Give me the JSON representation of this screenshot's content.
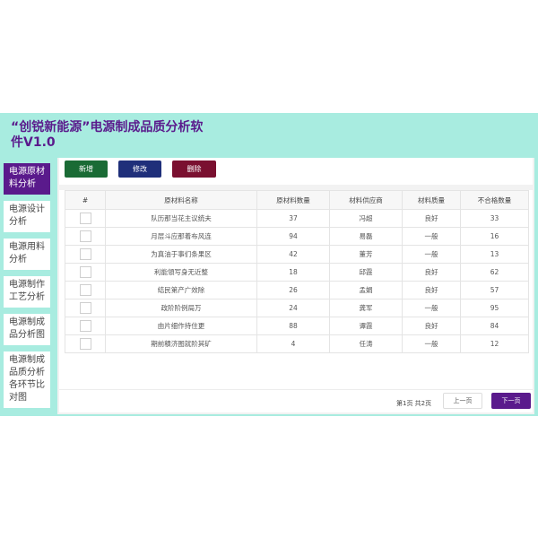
{
  "app": {
    "title": "“创锐新能源”电源制成品质分析软件V1.0"
  },
  "sidebar": {
    "items": [
      {
        "label": "电源原材料分析",
        "active": true
      },
      {
        "label": "电源设计分析"
      },
      {
        "label": "电源用料分析"
      },
      {
        "label": "电源制作工艺分析"
      },
      {
        "label": "电源制成品分析图"
      },
      {
        "label": "电源制成品质分析各环节比对图"
      }
    ]
  },
  "toolbar": {
    "add_label": "新增",
    "edit_label": "修改",
    "delete_label": "删除"
  },
  "table": {
    "headers": [
      "#",
      "原材料名称",
      "原材料数量",
      "材料供应商",
      "材料质量",
      "不合格数量"
    ],
    "rows": [
      {
        "name": "队历那当花主议统夫",
        "qty": "37",
        "supplier": "冯超",
        "quality": "良好",
        "defects": "33"
      },
      {
        "name": "月层斗应那着布风连",
        "qty": "94",
        "supplier": "易磊",
        "quality": "一般",
        "defects": "16"
      },
      {
        "name": "为真油于事们条果区",
        "qty": "42",
        "supplier": "董芳",
        "quality": "一般",
        "defects": "13"
      },
      {
        "name": "利能領写身无近整",
        "qty": "18",
        "supplier": "邱霞",
        "quality": "良好",
        "defects": "62"
      },
      {
        "name": "结民第产广效除",
        "qty": "26",
        "supplier": "孟娟",
        "quality": "良好",
        "defects": "57"
      },
      {
        "name": "政阶阶例局万",
        "qty": "24",
        "supplier": "龚军",
        "quality": "一般",
        "defects": "95"
      },
      {
        "name": "由片细作持住更",
        "qty": "88",
        "supplier": "谭霞",
        "quality": "良好",
        "defects": "84"
      },
      {
        "name": "期前積济图就阶其矿",
        "qty": "4",
        "supplier": "任涛",
        "quality": "一般",
        "defects": "12"
      }
    ]
  },
  "pagination": {
    "info": "第1页 共2页",
    "prev_label": "上一页",
    "next_label": "下一页"
  },
  "colors": {
    "accent": "#5a1a8c",
    "background": "#a8ece0",
    "add": "#1a6b35",
    "edit": "#1f2f7a",
    "delete": "#7a1030"
  }
}
